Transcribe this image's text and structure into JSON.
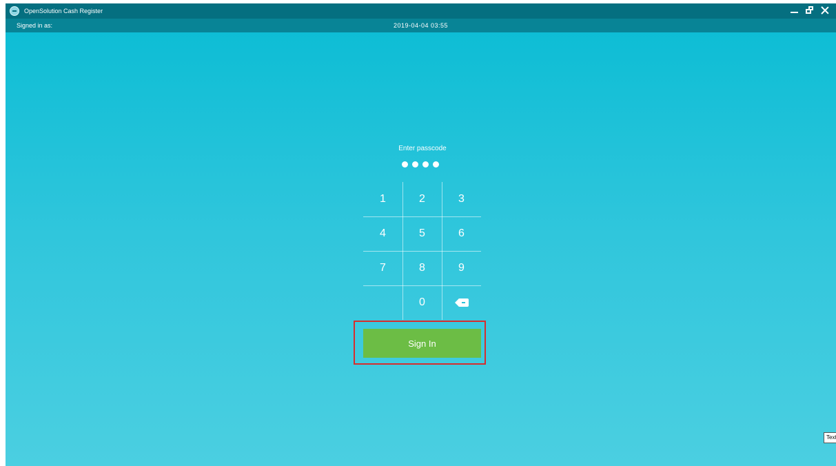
{
  "titlebar": {
    "app_title": "OpenSolution Cash Register",
    "app_icon": "app-logo-icon",
    "controls": {
      "minimize_icon": "minimize-icon",
      "restore_icon": "restore-icon",
      "close_icon": "close-icon"
    }
  },
  "statusbar": {
    "signed_in_label": "Signed in as:",
    "datetime": "2019-04-04 03:55"
  },
  "login": {
    "prompt": "Enter passcode",
    "passcode_length_entered": 4,
    "keypad": {
      "keys": [
        "1",
        "2",
        "3",
        "4",
        "5",
        "6",
        "7",
        "8",
        "9",
        "",
        "0",
        "backspace"
      ],
      "backspace_icon": "backspace-icon"
    },
    "sign_in_label": "Sign In"
  },
  "tooltip": {
    "text": "Text"
  },
  "colors": {
    "titlebar": "#056f80",
    "statusbar": "#088496",
    "background_top": "#09bcd4",
    "background_bottom": "#4bcfe1",
    "sign_in_button": "#6cbd45",
    "highlight_box": "#d82c2c"
  }
}
